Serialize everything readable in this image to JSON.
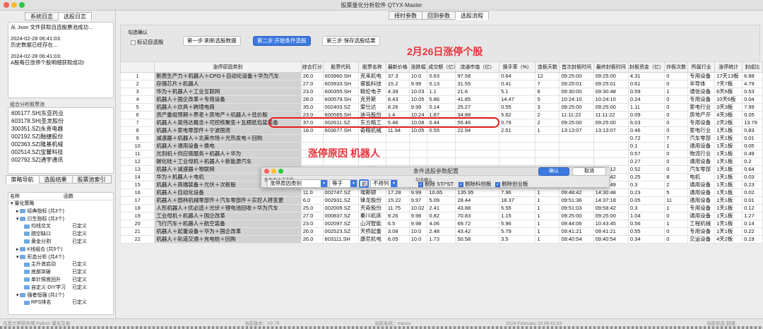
{
  "window": {
    "title": "股票量化分析软件 QTYX-Master"
  },
  "left": {
    "tabs": [
      "系统日志",
      "选股日志"
    ],
    "log_lines": [
      "从 Json 文件获取自选股票池成功...",
      "2024-02-28 06:41:03:",
      "历史数据已经存在...",
      "2024-02-28 06:41:03:",
      "A股每日涨停个股明细获取成功!"
    ],
    "pool_label": "组合分析股票池",
    "pool": [
      "605177.SH|东亚药业",
      "603178.SH|圣龙股份",
      "300351.SZ|永贵电器",
      "002192.SZ|融捷股份",
      "002363.SZ|隆基机械",
      "002514.SZ|宝馨科技",
      "002792.SZ|通宇通讯"
    ],
    "bottom_tabs": [
      "策略导航",
      "选股结果",
      "股票池索引"
    ],
    "tree_header": {
      "name": "名称",
      "func": "函数"
    },
    "tree": [
      {
        "label": "量化策略",
        "right": "",
        "level": 0
      },
      {
        "label": "经典指标 (共3个)",
        "right": "",
        "level": 1
      },
      {
        "label": "衍生指标 (共3个)",
        "right": "",
        "level": 1
      },
      {
        "label": "均线交叉",
        "right": "已定义",
        "level": 2
      },
      {
        "label": "跳空缺口",
        "right": "已定义",
        "level": 2
      },
      {
        "label": "黄金分割",
        "right": "已定义",
        "level": 2
      },
      {
        "label": "K线组合 (共5个)",
        "right": "",
        "level": 1
      },
      {
        "label": "形态分析 (共4个)",
        "right": "",
        "level": 1
      },
      {
        "label": "主升浪启动",
        "right": "已定义",
        "level": 2
      },
      {
        "label": "底部突破",
        "right": "已定义",
        "level": 2
      },
      {
        "label": "单针探底回升",
        "right": "已定义",
        "level": 2
      },
      {
        "label": "自定义-DIY学习",
        "right": "已定义",
        "level": 2
      },
      {
        "label": "强者恒强 (共1个)",
        "right": "",
        "level": 1
      },
      {
        "label": "RPS排名",
        "right": "已定义",
        "level": 2
      }
    ]
  },
  "right": {
    "tabs": [
      "择时参数",
      "回测参数",
      "选股流程"
    ],
    "ctrl_label": "勾选确认",
    "checkbox_label": "标记自选股",
    "step1": "第一步:刷新选股数据",
    "step2": "第二步:开始条件选股",
    "step3": "第三步:保存选股结果",
    "headline": "2月26日涨停个股",
    "columns": [
      "",
      "涨停原因类别",
      "综合打分",
      "股票代码",
      "股票名称",
      "最新价格",
      "涨跌幅",
      "成交额（亿）",
      "流通市值（亿）",
      "换手率（%）",
      "连板天数",
      "首次封板时间",
      "最终封板时间",
      "封板资金（亿）",
      "炸板次数",
      "所属行业",
      "涨停统计",
      "封成比"
    ],
    "rows": [
      [
        "1",
        "新质生产力＋机器人＋CPO＋自动化设备＋华为汽车",
        "26.0",
        "603960.SH",
        "克来机电",
        "37.3",
        "10.0",
        "0.63",
        "97.58",
        "0.64",
        "12",
        "09:25:00",
        "09:25:00",
        "4.31",
        "0",
        "专用设备",
        "17天13板",
        "6.88"
      ],
      [
        "2",
        "存储芯片＋机器人",
        "27.0",
        "603933.SH",
        "睿能科技",
        "15.2",
        "9.99",
        "0.13",
        "31.55",
        "0.41",
        "7",
        "09:25:01",
        "09:25:01",
        "0.61",
        "0",
        "半导体",
        "7天7板",
        "4.79"
      ],
      [
        "3",
        "华为＋机器人＋工业互联网",
        "23.0",
        "600355.SH",
        "精伦电子",
        "4.39",
        "10.03",
        "1.1",
        "21.6",
        "5.1",
        "6",
        "09:30:00",
        "09:30:48",
        "0.59",
        "1",
        "通信设备",
        "6天6板",
        "0.53"
      ],
      [
        "4",
        "机器人＋国企改革＋专用设备",
        "28.0",
        "600579.SH",
        "克劳斯",
        "8.43",
        "10.05",
        "5.86",
        "41.85",
        "14.47",
        "5",
        "10:24:10",
        "10:24:10",
        "0.24",
        "0",
        "专用设备",
        "10天6板",
        "0.04"
      ],
      [
        "5",
        "机器人＋炊具＋跨境电商",
        "35.0",
        "002403.SZ",
        "爱仕达",
        "8.26",
        "9.99",
        "0.14",
        "25.27",
        "0.55",
        "3",
        "09:25:00",
        "09:25:00",
        "1.11",
        "0",
        "家电行业",
        "3天3板",
        "7.99"
      ],
      [
        "6",
        "资产重组预期＋养老＋房地产＋机器人＋低价股",
        "23.0",
        "600565.SH",
        "迪马股份",
        "1.4",
        "10.24",
        "1.87",
        "34.88",
        "5.62",
        "2",
        "11:11:22",
        "11:11:22",
        "0.09",
        "0",
        "房地产开",
        "4天3板",
        "0.05"
      ],
      [
        "7",
        "机器人＋英伟达概念＋可控核聚变＋瓦楞纸包装装备",
        "37.0",
        "002611.SZ",
        "东方精工",
        "5.46",
        "10.08",
        "0.44",
        "55.46",
        "0.79",
        "2",
        "09:25:00",
        "09:25:00",
        "6.03",
        "0",
        "专用设备",
        "2天2板",
        "13.79"
      ],
      [
        "8",
        "机器人＋家电零部件＋宁波国资",
        "18.0",
        "603677.SH",
        "奇精机械",
        "11.94",
        "10.05",
        "0.55",
        "22.94",
        "2.51",
        "1",
        "13:13:07",
        "13:13:07",
        "0.46",
        "0",
        "家电行业",
        "1天1板",
        "0.83"
      ],
      [
        "9",
        "减速器＋机器人＋北美市场＋光热发电＋回购",
        "",
        "",
        "",
        "",
        "",
        "",
        "",
        "",
        "",
        "",
        "",
        "0.72",
        "7",
        "汽车零部",
        "1天1板",
        "0.01"
      ],
      [
        "10",
        "机器人＋通用设备＋换电",
        "",
        "",
        "",
        "",
        "",
        "",
        "",
        "",
        "",
        "",
        "",
        "0.1",
        "1",
        "通用设备",
        "1天1板",
        "0.05"
      ],
      [
        "11",
        "光刻机＋供应链服务＋机器人＋华为",
        "",
        "",
        "",
        "",
        "",
        "",
        "",
        "",
        "",
        "",
        "",
        "0.57",
        "0",
        "物流行业",
        "1天1板",
        "0.49"
      ],
      [
        "12",
        "碳化硅＋工业母机＋机器人＋新能源汽车",
        "",
        "",
        "",
        "",
        "",
        "",
        "",
        "",
        "",
        "",
        "",
        "0.27",
        "0",
        "通用设备",
        "1天1板",
        "0.2"
      ],
      [
        "13",
        "机器人＋减速器＋物联网",
        "26.0",
        "002553.SZ",
        "南方精工",
        "10.73",
        "10.05",
        "0.82",
        "25.51",
        "3.28",
        "1",
        "09:33:12",
        "09:33:12",
        "0.52",
        "0",
        "汽车零部",
        "1天1板",
        "0.64"
      ],
      [
        "14",
        "华为＋机器人＋电机",
        "8.0",
        "002892.SZ",
        "科力尔",
        "13.9",
        "9.97",
        "8.76",
        "38.3",
        "23.23",
        "1",
        "09:31:51",
        "14:25:42",
        "0.25",
        "8",
        "电机",
        "1天1板",
        "0.03"
      ],
      [
        "15",
        "机器人＋高端装备＋光伏＋次新股",
        "24.0",
        "873570.SZ",
        "坤博精工",
        "52.24",
        "29.98",
        "1.32",
        "4.02",
        "34.36",
        "1",
        "09:40:19",
        "09:46:49",
        "0.3",
        "2",
        "通用设备",
        "1天1板",
        "0.23"
      ],
      [
        "16",
        "机器人＋自动化设备",
        "11.0",
        "002747.SZ",
        "埃斯顿",
        "17.28",
        "9.99",
        "10.65",
        "135.95",
        "7.96",
        "1",
        "09:48:42",
        "14:30:48",
        "0.23",
        "5",
        "通用设备",
        "1天1板",
        "0.02"
      ],
      [
        "17",
        "机器人＋园林机械零部件＋汽车零部件＋实控人将变更",
        "6.0",
        "002931.SZ",
        "锋龙股份",
        "15.22",
        "9.97",
        "5.09",
        "28.44",
        "18.37",
        "1",
        "09:51:36",
        "14:37:18",
        "0.05",
        "11",
        "通用设备",
        "1天1板",
        "0.01"
      ],
      [
        "18",
        "人形机器人＋优必选＋光伏＋锂电池回收＋华为汽车",
        "25.0",
        "002009.SZ",
        "天奇股份",
        "11.75",
        "10.02",
        "2.41",
        "43.88",
        "5.55",
        "1",
        "09:51:03",
        "09:58:42",
        "0.3",
        "1",
        "专用设备",
        "1天1板",
        "0.12"
      ],
      [
        "19",
        "工业母机＋机器人＋国企改革",
        "27.0",
        "000837.SZ",
        "秦川机床",
        "9.26",
        "9.98",
        "0.82",
        "70.83",
        "1.15",
        "1",
        "09:25:00",
        "09:25:00",
        "1.04",
        "0",
        "通用设备",
        "1天1板",
        "1.27"
      ],
      [
        "20",
        "飞行汽车＋机器人＋航空装备",
        "23.0",
        "002097.SZ",
        "山河智能",
        "6.5",
        "9.98",
        "4.06",
        "69.72",
        "5.96",
        "1",
        "09:44:06",
        "10:43:45",
        "0.56",
        "1",
        "工程机械",
        "1天1板",
        "0.14"
      ],
      [
        "21",
        "机器人＋起重设备＋华为＋国企改革",
        "26.0",
        "002523.SZ",
        "天桥起重",
        "3.08",
        "10.0",
        "2.48",
        "43.42",
        "5.79",
        "1",
        "09:41:21",
        "09:41:21",
        "0.55",
        "0",
        "专用设备",
        "1天1板",
        "0.22"
      ],
      [
        "22",
        "机器人＋轨道交通＋充电桩＋回购",
        "26.0",
        "603111.SH",
        "康尼机电",
        "6.05",
        "10.0",
        "1.73",
        "50.58",
        "3.5",
        "1",
        "09:40:54",
        "09:40:54",
        "0.34",
        "0",
        "交运设备",
        "4天2板",
        "0.19"
      ]
    ],
    "partial_rows": [
      {
        "code": "002553.SZ",
        "name": "南方精工",
        "price": "10.73",
        "pct": "10.05",
        "amt": "0.82",
        "cap": "25.51",
        "turn": "3.28",
        "t": "09:33:12"
      }
    ]
  },
  "dialog": {
    "title": "条件选股参数配置",
    "annotation": "涨停原因 机器人",
    "expr_label": "条件表达式选股",
    "field": "涨停原因类别",
    "op": "等于",
    "value": "机",
    "sort": "不排列",
    "confirm_label": "勾选确认",
    "checks": [
      "剔除 ST/*ST",
      "剔除科创板",
      "剔除创业板"
    ],
    "ok": "确认",
    "cancel": "取消"
  },
  "status": {
    "author": "元宽大师带你用 Python 量化交易",
    "version": "当前版本：V2.79",
    "system": "当前系统：macos",
    "time": "2024-February-28 06:41:03",
    "state": "当前状态:就绪"
  },
  "colors": {
    "accent": "#3b78e0",
    "annotation": "#e8333a",
    "oval": "#e21b1b"
  }
}
